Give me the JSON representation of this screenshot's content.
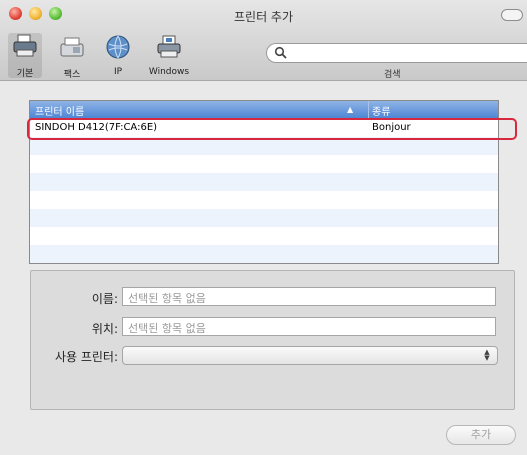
{
  "window": {
    "title": "프린터 추가"
  },
  "toolbar": {
    "items": [
      {
        "label": "기본",
        "icon": "default-printer-icon"
      },
      {
        "label": "팩스",
        "icon": "fax-icon"
      },
      {
        "label": "IP",
        "icon": "globe-icon"
      },
      {
        "label": "Windows",
        "icon": "windows-printer-icon"
      }
    ],
    "search": {
      "placeholder": "",
      "label": "검색"
    }
  },
  "printer_list": {
    "columns": {
      "name": "프린터 이름",
      "sort_indicator": "▲",
      "kind": "종류"
    },
    "rows": [
      {
        "name": "SINDOH D412(7F:CA:6E)",
        "kind": "Bonjour"
      }
    ]
  },
  "details": {
    "name_label": "이름:",
    "name_value": "선택된 항목 없음",
    "location_label": "위치:",
    "location_value": "선택된 항목 없음",
    "driver_label": "사용 프린터:",
    "driver_value": ""
  },
  "actions": {
    "add_label": "추가"
  },
  "colors": {
    "highlight": "#d8283f",
    "header": "#4f86d4"
  }
}
